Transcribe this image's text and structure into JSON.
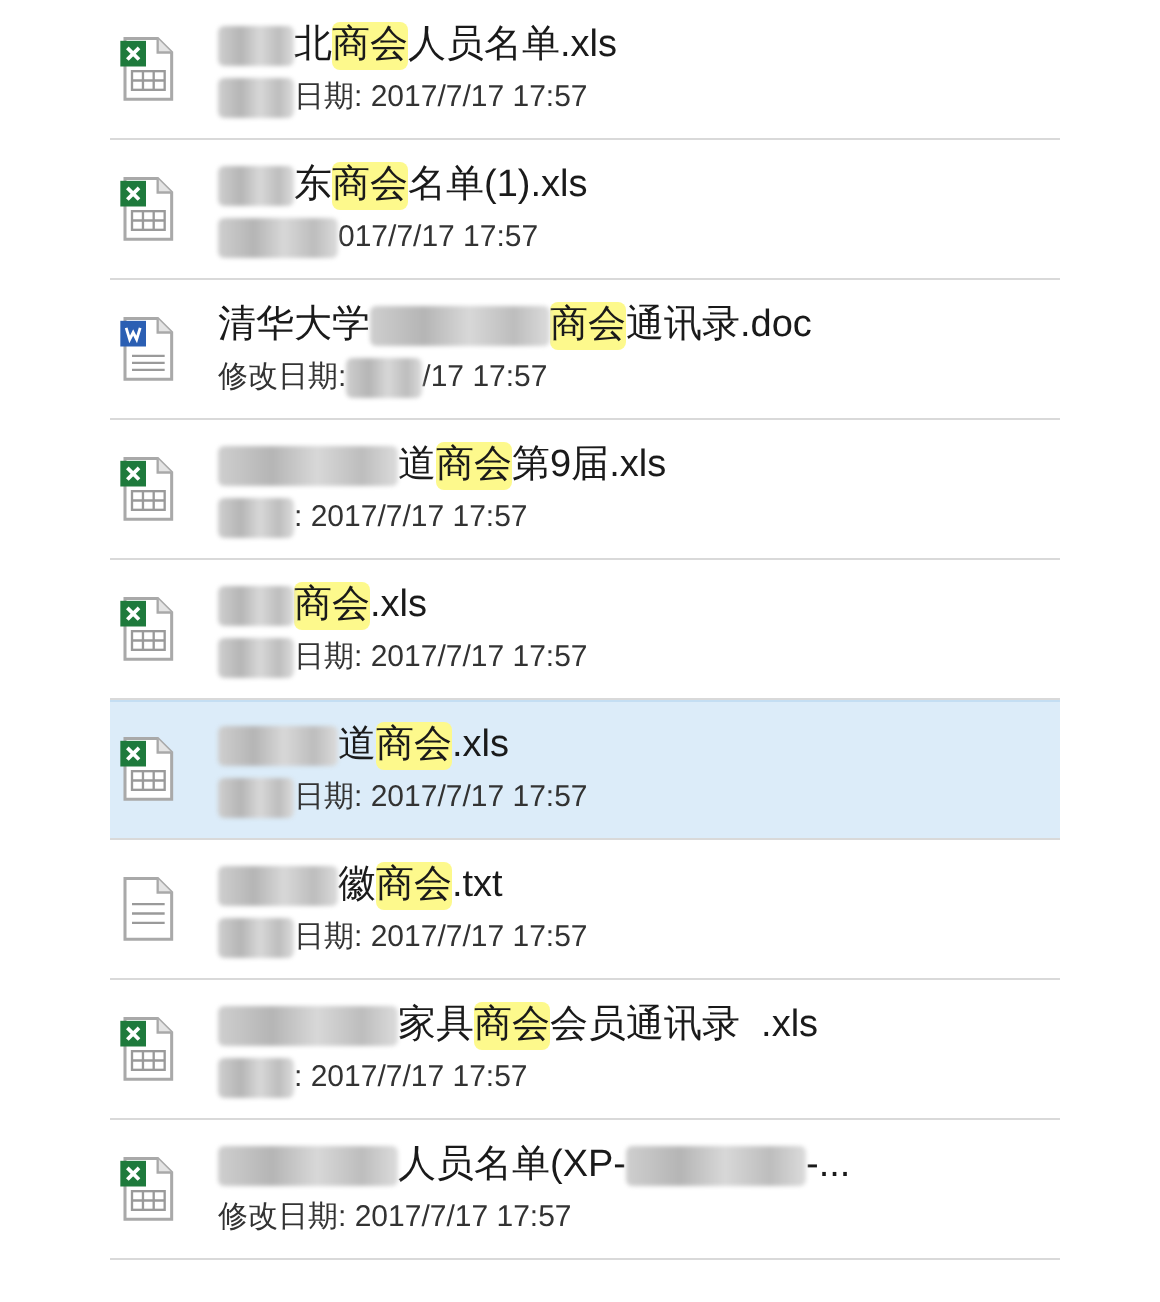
{
  "results": [
    {
      "kind": "xls",
      "selected": false,
      "name": [
        {
          "kind": "redacted_short"
        },
        {
          "kind": "text",
          "text": "北"
        },
        {
          "kind": "highlight",
          "text": "商会"
        },
        {
          "kind": "text",
          "text": "人员名单.xls"
        }
      ],
      "date": [
        {
          "kind": "redacted_short"
        },
        {
          "kind": "text",
          "text": "日期: 2017/7/17 17:57"
        }
      ]
    },
    {
      "kind": "xls",
      "selected": false,
      "name": [
        {
          "kind": "redacted_short"
        },
        {
          "kind": "text",
          "text": "东"
        },
        {
          "kind": "highlight",
          "text": "商会"
        },
        {
          "kind": "text",
          "text": "名单(1).xls"
        }
      ],
      "date": [
        {
          "kind": "redacted_medium"
        },
        {
          "kind": "text",
          "text": "017/7/17 17:57"
        }
      ]
    },
    {
      "kind": "doc",
      "selected": false,
      "name": [
        {
          "kind": "text",
          "text": "清华大学"
        },
        {
          "kind": "redacted_long"
        },
        {
          "kind": "highlight",
          "text": "商会"
        },
        {
          "kind": "text",
          "text": "通讯录.doc"
        }
      ],
      "date": [
        {
          "kind": "text",
          "text": "修改日期:"
        },
        {
          "kind": "redacted_short"
        },
        {
          "kind": "text",
          "text": "/17 17:57"
        }
      ]
    },
    {
      "kind": "xls",
      "selected": false,
      "name": [
        {
          "kind": "redacted_long"
        },
        {
          "kind": "text",
          "text": "道"
        },
        {
          "kind": "highlight",
          "text": "商会"
        },
        {
          "kind": "text",
          "text": "第9届.xls"
        }
      ],
      "date": [
        {
          "kind": "redacted_short"
        },
        {
          "kind": "text",
          "text": ": 2017/7/17 17:57"
        }
      ]
    },
    {
      "kind": "xls",
      "selected": false,
      "name": [
        {
          "kind": "redacted_short"
        },
        {
          "kind": "highlight",
          "text": "商会"
        },
        {
          "kind": "text",
          "text": ".xls"
        }
      ],
      "date": [
        {
          "kind": "redacted_short"
        },
        {
          "kind": "text",
          "text": "日期: 2017/7/17 17:57"
        }
      ]
    },
    {
      "kind": "xls",
      "selected": true,
      "name": [
        {
          "kind": "redacted_medium"
        },
        {
          "kind": "text",
          "text": "道"
        },
        {
          "kind": "highlight",
          "text": "商会"
        },
        {
          "kind": "text",
          "text": ".xls"
        }
      ],
      "date": [
        {
          "kind": "redacted_short"
        },
        {
          "kind": "text",
          "text": "日期: 2017/7/17 17:57"
        }
      ]
    },
    {
      "kind": "txt",
      "selected": false,
      "name": [
        {
          "kind": "redacted_medium"
        },
        {
          "kind": "text",
          "text": "徽"
        },
        {
          "kind": "highlight",
          "text": "商会"
        },
        {
          "kind": "text",
          "text": ".txt"
        }
      ],
      "date": [
        {
          "kind": "redacted_short"
        },
        {
          "kind": "text",
          "text": "日期: 2017/7/17 17:57"
        }
      ]
    },
    {
      "kind": "xls",
      "selected": false,
      "name": [
        {
          "kind": "redacted_long"
        },
        {
          "kind": "text",
          "text": "家具"
        },
        {
          "kind": "highlight",
          "text": "商会"
        },
        {
          "kind": "text",
          "text": "会员通讯录  .xls"
        }
      ],
      "date": [
        {
          "kind": "redacted_short"
        },
        {
          "kind": "text",
          "text": ": 2017/7/17 17:57"
        }
      ]
    },
    {
      "kind": "xls",
      "selected": false,
      "name": [
        {
          "kind": "redacted_long"
        },
        {
          "kind": "text",
          "text": "人员名单(XP-"
        },
        {
          "kind": "redacted_long"
        },
        {
          "kind": "text",
          "text": "-..."
        }
      ],
      "date": [
        {
          "kind": "text",
          "text": "修改日期: 2017/7/17 17:57"
        }
      ]
    }
  ]
}
